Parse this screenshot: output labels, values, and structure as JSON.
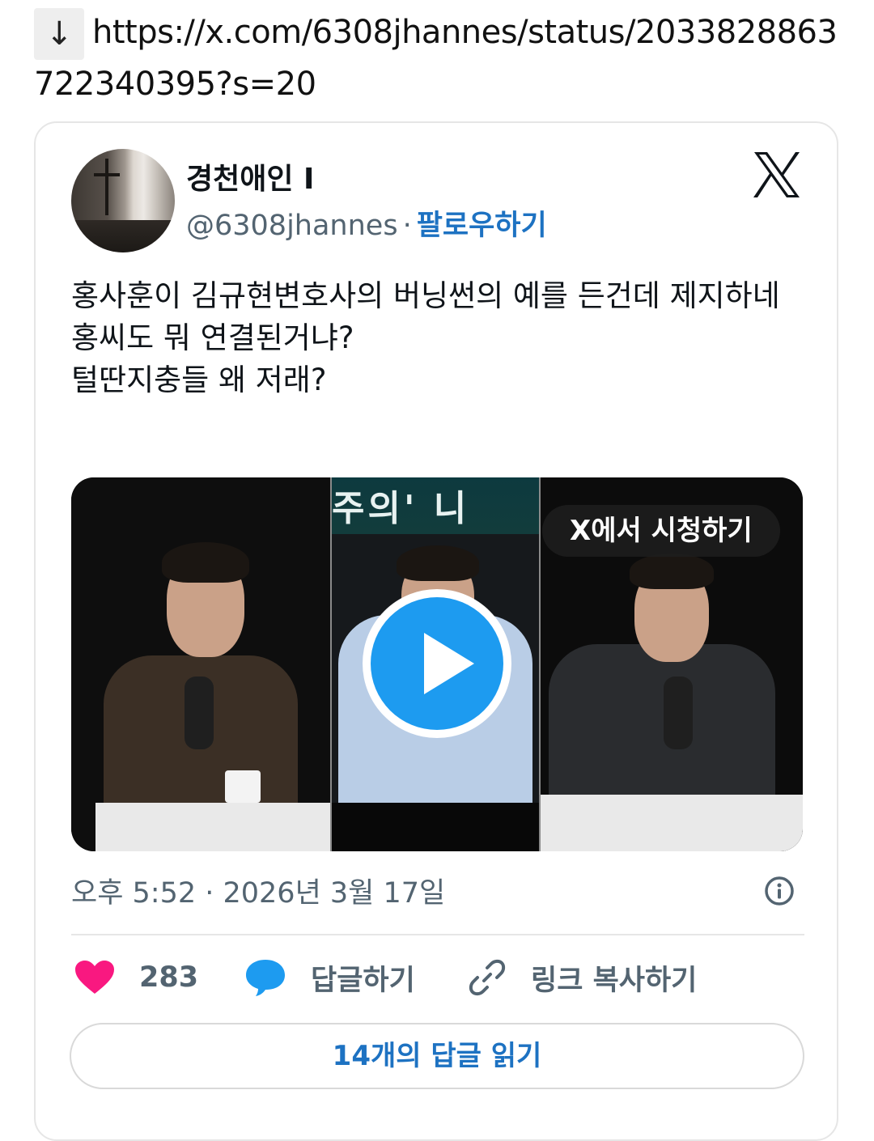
{
  "header": {
    "download_glyph": "↓",
    "url": "https://x.com/6308jhannes/status/2033828863722340395?s=20"
  },
  "tweet": {
    "author_name": "경천애인 I",
    "handle": "@6308jhannes",
    "separator": "·",
    "follow_label": "팔로우하기",
    "text_lines": [
      "홍사훈이 김규현변호사의 버닝썬의 예를 든건데 제지하네",
      "홍씨도 뭐 연결된거냐?",
      "털딴지충들 왜 저래?"
    ],
    "media": {
      "watch_label": "X에서 시청하기",
      "banner_text": "주의' 니",
      "play_icon": "play-icon"
    },
    "timestamp": "오후 5:52 · 2026년 3월 17일",
    "actions": {
      "like_count": "283",
      "reply_label": "답글하기",
      "copy_link_label": "링크 복사하기"
    },
    "read_replies_label": "14개의 답글 읽기"
  },
  "colors": {
    "accent": "#1d72c2",
    "like": "#f91880",
    "reply": "#1d9bf0",
    "muted": "#536471"
  }
}
